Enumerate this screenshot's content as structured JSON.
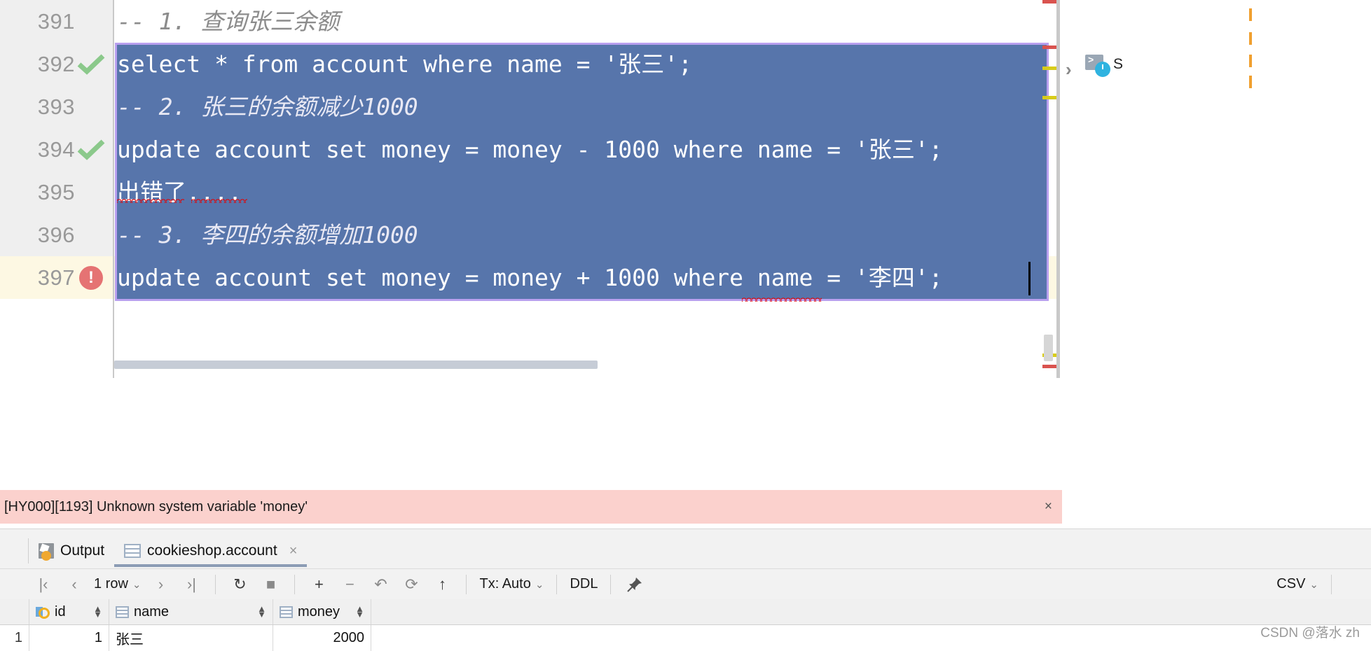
{
  "editor": {
    "lines": [
      {
        "num": "391",
        "status": "none",
        "text": "-- 1. 查询张三余额",
        "kind": "comment",
        "selected": false
      },
      {
        "num": "392",
        "status": "check",
        "text": "select * from account where name = '张三';",
        "kind": "sql",
        "selected": true
      },
      {
        "num": "393",
        "status": "none",
        "text": "-- 2. 张三的余额减少1000",
        "kind": "comment",
        "selected": true
      },
      {
        "num": "394",
        "status": "check",
        "text": "update account set money = money - 1000 where name = '张三';",
        "kind": "sql",
        "selected": true
      },
      {
        "num": "395",
        "status": "none",
        "text": "出错了....",
        "kind": "sql",
        "selected": true
      },
      {
        "num": "396",
        "status": "none",
        "text": "-- 3. 李四的余额增加1000",
        "kind": "comment",
        "selected": true
      },
      {
        "num": "397",
        "status": "error",
        "text": "update account set money = money + 1000 where name = '李四';",
        "kind": "sql",
        "selected": true
      }
    ],
    "selection_color": "#5775ab",
    "selection_border_color": "#b9a0ef",
    "error_line_bg": "#fdf8e3",
    "comment_color": "#8c8c8c",
    "squiggle_color": "#e60000"
  },
  "right_strip": {
    "chevron": "›",
    "icon_name": "sql-console-icon",
    "label": "S"
  },
  "error_bar": {
    "message": "[HY000][1193] Unknown system variable 'money'",
    "close_label": "×",
    "bg_color": "#fbd1cd"
  },
  "results": {
    "tabs": [
      {
        "label": "Output",
        "icon": "output-icon",
        "active": false,
        "closable": false
      },
      {
        "label": "cookieshop.account",
        "icon": "table-icon",
        "active": true,
        "closable": true,
        "close_label": "×"
      }
    ],
    "toolbar": {
      "first_page": "|‹",
      "prev_page": "‹",
      "row_count": "1 row",
      "row_count_caret": "⌄",
      "next_page": "›",
      "last_page": "›|",
      "refresh": "↻",
      "stop": "■",
      "add_row": "+",
      "remove_row": "−",
      "revert": "↶",
      "revert_selected": "⟳",
      "submit": "↑",
      "tx_label": "Tx: Auto",
      "tx_caret": "⌄",
      "ddl_label": "DDL",
      "pin": "pin-icon",
      "export_label": "CSV",
      "export_caret": "⌄"
    },
    "table": {
      "columns": [
        {
          "label": "id",
          "icon": "primary-key-icon",
          "sortable": true
        },
        {
          "label": "name",
          "icon": "column-icon",
          "sortable": true
        },
        {
          "label": "money",
          "icon": "column-icon",
          "sortable": true
        }
      ],
      "rows": [
        {
          "num": "1",
          "id": "1",
          "name": "张三",
          "money": "2000"
        }
      ]
    }
  },
  "watermark": "CSDN @落水 zh"
}
